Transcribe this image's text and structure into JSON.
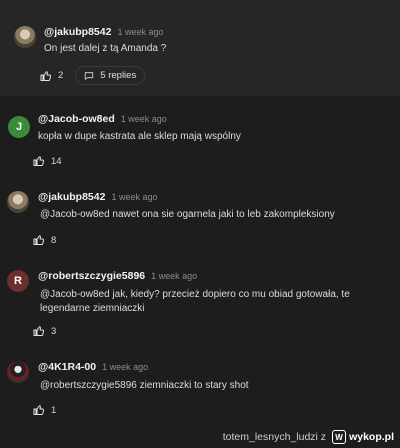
{
  "comments": [
    {
      "author": "@jakubp8542",
      "time": "1 week ago",
      "text": "On jest dalej z tą Amanda ?",
      "likes": "2",
      "replies": "5 replies",
      "avatar_icon": "user-photo-icon"
    },
    {
      "author": "@Jacob-ow8ed",
      "time": "1 week ago",
      "text": "kopła w dupe kastrata ale sklep mają wspólny",
      "likes": "14",
      "avatar_letter": "J",
      "avatar_color": "#3c8a3c"
    },
    {
      "author": "@jakubp8542",
      "time": "1 week ago",
      "text": "@Jacob-ow8ed  nawet ona sie ogarnela jaki to leb zakompleksiony",
      "likes": "8",
      "avatar_icon": "user-photo-icon"
    },
    {
      "author": "@robertszczygie5896",
      "time": "1 week ago",
      "text": "@Jacob-ow8ed  jak, kiedy? przecież dopiero co mu obiad gotowała, te legendarne ziemniaczki",
      "likes": "3",
      "avatar_letter": "R",
      "avatar_color": "#6b2f2f"
    },
    {
      "author": "@4K1R4-00",
      "time": "1 week ago",
      "text": "@robertszczygie5896  ziemniaczki to stary shot",
      "likes": "1",
      "avatar_icon": "user-photo-icon"
    }
  ],
  "footer": {
    "source": "totem_lesnych_ludzi z",
    "brand": "wykop.pl"
  }
}
